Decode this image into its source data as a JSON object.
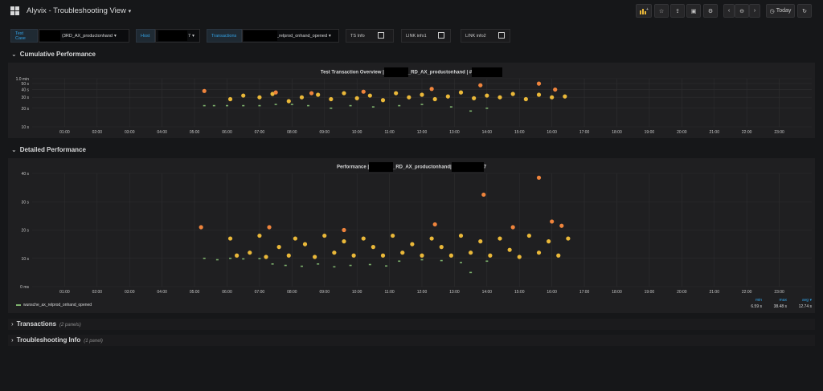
{
  "app": {
    "title": "Alyvix - Troubleshooting View",
    "title_caret": "▾"
  },
  "toolbar": {
    "today_label": "Today"
  },
  "variables": {
    "test_case": {
      "label": "Test Case",
      "value": "RD_AX_productonhand",
      "prefix": "(3"
    },
    "host": {
      "label": "Host",
      "value": "7"
    },
    "transactions": {
      "label": "Transactions",
      "value": "_relprod_onhand_opened"
    },
    "ts_info": {
      "label": "TS Info"
    },
    "link_info1": {
      "label": "LINK info1"
    },
    "link_info2": {
      "label": "LINK info2"
    }
  },
  "rows": {
    "cumulative": "Cumulative Performance",
    "detailed": "Detailed Performance",
    "transactions": {
      "title": "Transactions",
      "sub": "(2 panels)"
    },
    "troubleshooting": {
      "title": "Troubleshooting Info",
      "sub": "(1 panel)"
    }
  },
  "panels": {
    "overview": {
      "title_a": "Test Transaction Overview |",
      "title_b": "_RD_AX_productonhand | #"
    },
    "performance": {
      "title_a": "Performance |",
      "title_b": "_RD_AX_productonhand|",
      "title_c": "7"
    }
  },
  "legend": {
    "series": "wunsche_ax_relprod_onhand_opened",
    "min_label": "min",
    "max_label": "max",
    "avg_label": "avg",
    "min": "6.59 s",
    "max": "38.48 s",
    "avg": "12.74 s"
  },
  "colors": {
    "green": "#7eb26d",
    "yellow": "#eab839",
    "orange": "#ef843c",
    "accent": "#33a2e5"
  },
  "chart_data": [
    {
      "type": "scatter",
      "title": "Test Transaction Overview",
      "x_ticks": [
        "01:00",
        "02:00",
        "03:00",
        "04:00",
        "05:00",
        "06:00",
        "07:00",
        "08:00",
        "09:00",
        "10:00",
        "11:00",
        "12:00",
        "13:00",
        "14:00",
        "15:00",
        "16:00",
        "17:00",
        "18:00",
        "19:00",
        "20:00",
        "21:00",
        "22:00",
        "23:00"
      ],
      "y_ticks": [
        "10 s",
        "20 s",
        "30 s",
        "40 s",
        "50 s",
        "1.0 min"
      ],
      "ylim": [
        10,
        60
      ],
      "y_scale": "log",
      "x_range_hours": [
        5.0,
        16.7
      ],
      "series": [
        {
          "name": "green",
          "color": "#7eb26d",
          "values": [
            [
              5.3,
              22
            ],
            [
              5.6,
              22
            ],
            [
              6.0,
              22
            ],
            [
              6.5,
              22
            ],
            [
              7.0,
              22
            ],
            [
              7.5,
              23
            ],
            [
              8.0,
              23
            ],
            [
              8.5,
              22
            ],
            [
              9.2,
              20
            ],
            [
              9.8,
              22
            ],
            [
              10.5,
              21
            ],
            [
              11.3,
              22
            ],
            [
              12.0,
              23
            ],
            [
              12.9,
              21
            ],
            [
              13.5,
              18
            ],
            [
              14.0,
              20
            ]
          ]
        },
        {
          "name": "yellow",
          "color": "#eab839",
          "values": [
            [
              6.1,
              28
            ],
            [
              6.5,
              32
            ],
            [
              7.0,
              30
            ],
            [
              7.4,
              34
            ],
            [
              7.9,
              26
            ],
            [
              8.3,
              30
            ],
            [
              8.8,
              33
            ],
            [
              9.2,
              28
            ],
            [
              9.6,
              35
            ],
            [
              10.0,
              29
            ],
            [
              10.4,
              32
            ],
            [
              10.8,
              27
            ],
            [
              11.2,
              35
            ],
            [
              11.6,
              30
            ],
            [
              12.0,
              33
            ],
            [
              12.4,
              28
            ],
            [
              12.8,
              31
            ],
            [
              13.2,
              36
            ],
            [
              13.6,
              29
            ],
            [
              14.0,
              32
            ],
            [
              14.4,
              30
            ],
            [
              14.8,
              34
            ],
            [
              15.2,
              28
            ],
            [
              15.6,
              33
            ],
            [
              16.0,
              30
            ],
            [
              16.4,
              31
            ]
          ]
        },
        {
          "name": "orange",
          "color": "#ef843c",
          "values": [
            [
              5.3,
              38
            ],
            [
              7.5,
              36
            ],
            [
              8.6,
              35
            ],
            [
              10.2,
              37
            ],
            [
              12.3,
              41
            ],
            [
              13.8,
              47
            ],
            [
              15.6,
              50
            ],
            [
              16.1,
              40
            ]
          ]
        }
      ]
    },
    {
      "type": "scatter",
      "title": "Performance",
      "x_ticks": [
        "01:00",
        "02:00",
        "03:00",
        "04:00",
        "05:00",
        "06:00",
        "07:00",
        "08:00",
        "09:00",
        "10:00",
        "11:00",
        "12:00",
        "13:00",
        "14:00",
        "15:00",
        "16:00",
        "17:00",
        "18:00",
        "19:00",
        "20:00",
        "21:00",
        "22:00",
        "23:00"
      ],
      "y_ticks": [
        "0 ms",
        "10 s",
        "20 s",
        "30 s",
        "40 s"
      ],
      "ylim": [
        0,
        40
      ],
      "x_range_hours": [
        5.0,
        16.7
      ],
      "series": [
        {
          "name": "wunsche_ax_relprod_onhand_opened",
          "color": "#7eb26d",
          "values": [
            [
              5.3,
              10
            ],
            [
              5.7,
              9.5
            ],
            [
              6.1,
              10
            ],
            [
              6.5,
              9.8
            ],
            [
              7.0,
              9.9
            ],
            [
              7.4,
              8
            ],
            [
              7.8,
              7.5
            ],
            [
              8.3,
              7.2
            ],
            [
              8.8,
              8
            ],
            [
              9.3,
              7
            ],
            [
              9.8,
              7.5
            ],
            [
              10.4,
              7.8
            ],
            [
              10.9,
              7.3
            ],
            [
              11.3,
              9
            ],
            [
              12.0,
              9.5
            ],
            [
              12.6,
              9.2
            ],
            [
              13.2,
              8.5
            ],
            [
              13.5,
              5.0
            ],
            [
              14.0,
              9
            ]
          ]
        },
        {
          "name": "yellow",
          "color": "#eab839",
          "values": [
            [
              6.1,
              17
            ],
            [
              6.3,
              11
            ],
            [
              6.7,
              12
            ],
            [
              7.0,
              18
            ],
            [
              7.2,
              10.5
            ],
            [
              7.6,
              14
            ],
            [
              7.9,
              11
            ],
            [
              8.1,
              17
            ],
            [
              8.4,
              15
            ],
            [
              8.7,
              10.5
            ],
            [
              9.0,
              18
            ],
            [
              9.3,
              12
            ],
            [
              9.6,
              16
            ],
            [
              9.9,
              11
            ],
            [
              10.2,
              17
            ],
            [
              10.5,
              14
            ],
            [
              10.8,
              11
            ],
            [
              11.1,
              18
            ],
            [
              11.4,
              12
            ],
            [
              11.7,
              15
            ],
            [
              12.0,
              11
            ],
            [
              12.3,
              17
            ],
            [
              12.6,
              14
            ],
            [
              12.9,
              11
            ],
            [
              13.2,
              18
            ],
            [
              13.5,
              12
            ],
            [
              13.8,
              16
            ],
            [
              14.1,
              11
            ],
            [
              14.4,
              17
            ],
            [
              14.7,
              13
            ],
            [
              15.0,
              10.5
            ],
            [
              15.3,
              18
            ],
            [
              15.6,
              12
            ],
            [
              15.9,
              16
            ],
            [
              16.2,
              11
            ],
            [
              16.5,
              17
            ]
          ]
        },
        {
          "name": "orange",
          "color": "#ef843c",
          "values": [
            [
              5.2,
              21
            ],
            [
              7.3,
              21
            ],
            [
              9.6,
              20
            ],
            [
              12.4,
              22
            ],
            [
              13.9,
              32.5
            ],
            [
              14.8,
              21
            ],
            [
              15.6,
              38.5
            ],
            [
              16.0,
              23
            ],
            [
              16.3,
              21.5
            ]
          ]
        }
      ]
    }
  ]
}
